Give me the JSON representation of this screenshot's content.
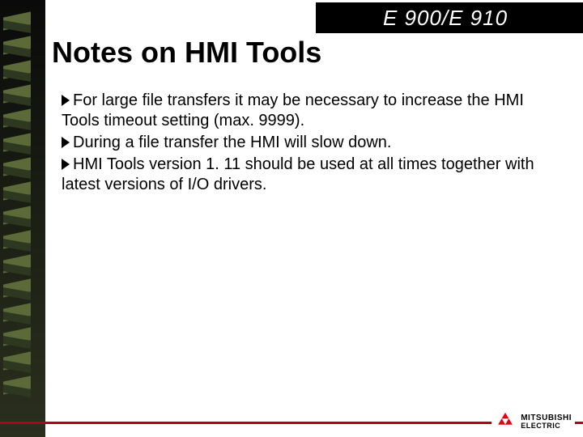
{
  "header": {
    "label": "E 900/E 910"
  },
  "title": "Notes on HMI Tools",
  "bullets": [
    "For large file transfers it may be necessary to increase the HMI Tools timeout setting (max. 9999).",
    "During a file transfer the HMI will slow down.",
    "HMI Tools version 1. 11 should be used at all times together with latest versions of I/O drivers."
  ],
  "logo": {
    "line1": "MITSUBISHI",
    "line2": "ELECTRIC"
  }
}
